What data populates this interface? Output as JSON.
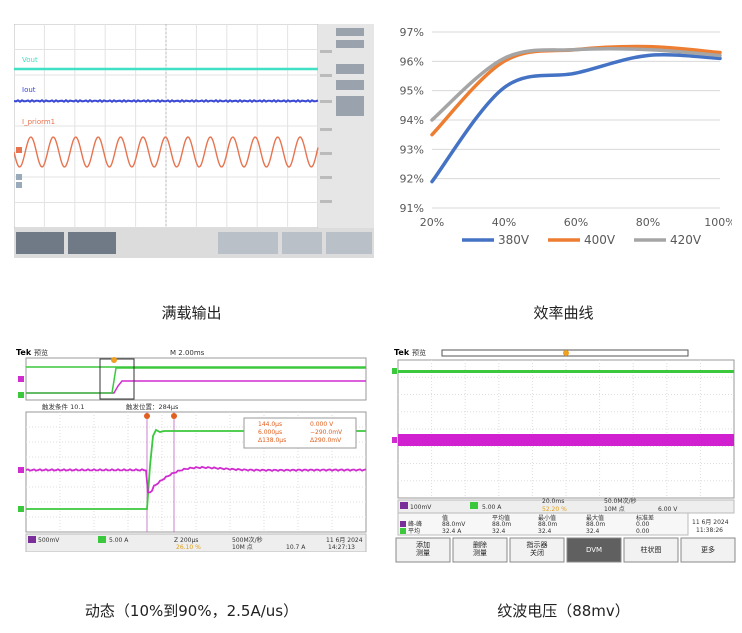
{
  "captions": {
    "full_load": "满载输出",
    "efficiency": "效率曲线",
    "dynamic": "动态（10%到90%，2.5A/us）",
    "ripple": "纹波电压（88mv）"
  },
  "scope1": {
    "labels": [
      "Vout",
      "Iout",
      "I_priorm1"
    ],
    "colors": {
      "vout": "#3fe0c4",
      "iout": "#3a49d6",
      "iprim": "#e8734f"
    }
  },
  "chart_data": {
    "type": "line",
    "categories": [
      "20%",
      "40%",
      "60%",
      "80%",
      "100%"
    ],
    "yticks": [
      "91%",
      "92%",
      "93%",
      "94%",
      "95%",
      "96%",
      "97%"
    ],
    "ylim": [
      91,
      97
    ],
    "grid": true,
    "legend": "bottom",
    "series": [
      {
        "name": "380V",
        "color": "#4472c4",
        "values": [
          91.9,
          95.1,
          95.6,
          96.2,
          96.1
        ]
      },
      {
        "name": "400V",
        "color": "#ed7d31",
        "values": [
          93.5,
          96.0,
          96.4,
          96.5,
          96.3
        ]
      },
      {
        "name": "420V",
        "color": "#a5a5a5",
        "values": [
          94.0,
          96.1,
          96.4,
          96.4,
          96.2
        ]
      }
    ]
  },
  "scope3": {
    "brand": "Tek",
    "mode": "预览",
    "timebase": "M 2.00ms",
    "trigger_info": "触发条件 10.1",
    "trigger_pos": "触发位置：284μs",
    "cursor_a": "144.0μs",
    "cursor_b": "6.000μs",
    "cursor_delta": "Δ138.0μs",
    "cursor_va": "0.000 V",
    "cursor_vb": "−290.0mV",
    "cursor_dv": "Δ290.0mV",
    "ch3_scale": "500mV",
    "ch4_scale": "5.00 A",
    "horiz": "Z 200μs",
    "sample_rate": "500M次/秒",
    "record": "10M 点",
    "trig_level": "10.7 A",
    "trig_pct": "26.10 %",
    "date": "11 6月 2024",
    "time": "14:27:13"
  },
  "scope4": {
    "brand": "Tek",
    "mode": "预览",
    "ch3_scale": "100mV",
    "ch4_scale": "5.00 A",
    "timebase": "20.0ms",
    "sample_rate": "50.0M次/秒",
    "record": "10M 点",
    "trig_level": "6.00 V",
    "trig_pct": "52.20 %",
    "meas_headers": [
      "值",
      "平均值",
      "最小值",
      "最大值",
      "标准差"
    ],
    "meas_rows": [
      {
        "name": "峰-峰",
        "values": [
          "88.0mV",
          "88.0m",
          "88.0m",
          "88.0m",
          "0.00"
        ]
      },
      {
        "name": "平均",
        "values": [
          "32.4 A",
          "32.4",
          "32.4",
          "32.4",
          "0.00"
        ]
      }
    ],
    "date": "11 6月 2024",
    "time": "11:38:26",
    "buttons": [
      "添加\n测量",
      "删除\n测量",
      "指示器\n关闭",
      "DVM",
      "柱状图",
      "更多"
    ]
  }
}
